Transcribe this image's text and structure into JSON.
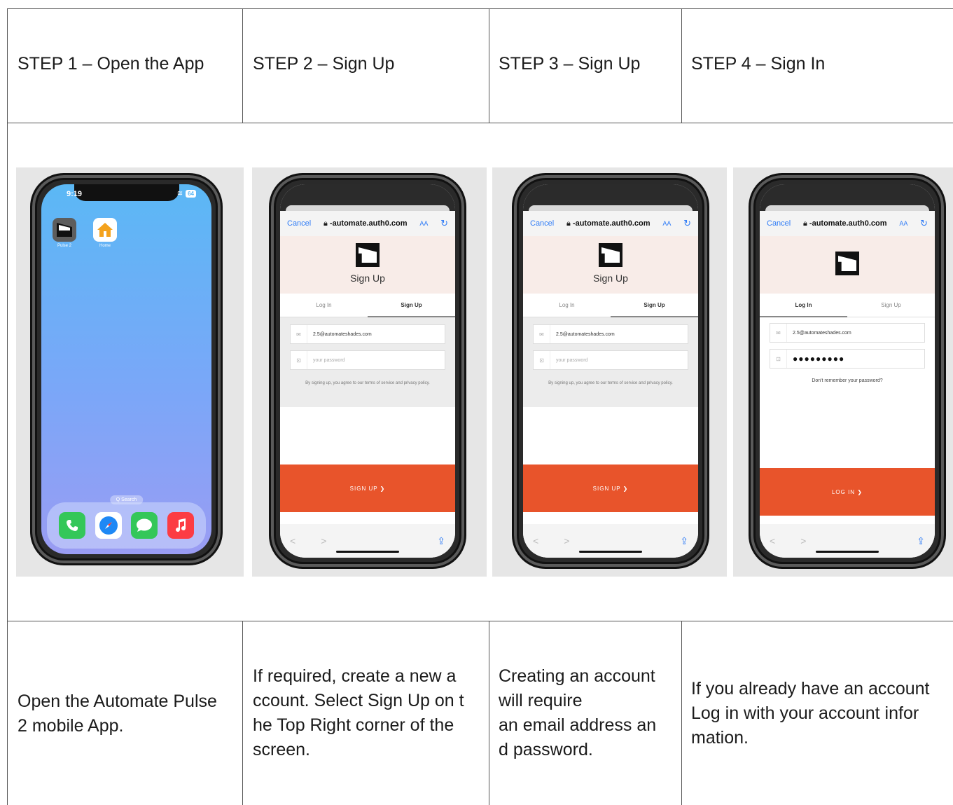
{
  "steps": [
    {
      "title": "STEP 1 – Open the App",
      "description_lines": [
        "Open the Automate Pulse",
        "2 mobile App."
      ]
    },
    {
      "title": "STEP 2 – Sign Up",
      "description_lines": [
        "If required, create a new a",
        "ccount. Select Sign Up on t",
        "he Top Right corner of the",
        "screen."
      ]
    },
    {
      "title": "STEP 3 – Sign Up",
      "description_lines": [
        "Creating an account",
        "will require",
        "an email address an",
        "d password."
      ]
    },
    {
      "title": "STEP 4 – Sign In",
      "description_lines": [
        "If you already have an account",
        "Log in with your account infor",
        "mation."
      ]
    }
  ],
  "home_screen": {
    "time": "9:19",
    "battery": "64",
    "apps": [
      {
        "label": "Pulse 2",
        "icon": "pulse-app-icon"
      },
      {
        "label": "Home",
        "icon": "home-app-icon"
      }
    ],
    "search_label": "Q Search",
    "dock": [
      "phone-icon",
      "safari-icon",
      "messages-icon",
      "music-icon"
    ],
    "colors": {
      "gradient_top": "#5bb8f5",
      "gradient_bottom": "#9a9cf3"
    }
  },
  "browser": {
    "cancel": "Cancel",
    "host": "-automate.auth0.com",
    "text_size": "AA",
    "reload_icon": "reload-icon",
    "lock_icon": "lock-icon",
    "back": "<",
    "forward": ">",
    "share_icon": "share-icon"
  },
  "auth": {
    "brand_title_signup": "Sign Up",
    "tab_login": "Log In",
    "tab_signup": "Sign Up",
    "email": "2.5@automateshades.com",
    "password_placeholder": "your password",
    "password_masked": "●●●●●●●●●",
    "terms": "By signing up, you agree to our terms of service and privacy policy.",
    "forgot": "Don't remember your password?",
    "signup_cta": "SIGN UP ❯",
    "login_cta": "LOG IN ❯",
    "accent": "#e8542b"
  }
}
